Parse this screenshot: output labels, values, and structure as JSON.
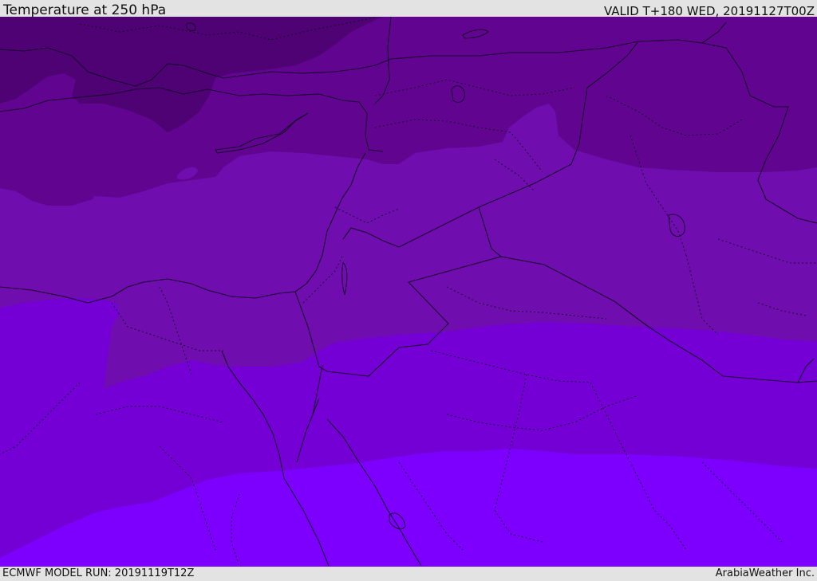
{
  "header": {
    "title": "Temperature at 250 hPa",
    "valid": "VALID T+180 WED, 20191127T00Z"
  },
  "footer": {
    "model_run": "ECMWF MODEL RUN: 20191119T12Z",
    "credit": "ArabiaWeather Inc."
  },
  "colors": {
    "band_coldest": "#4f0274",
    "band_cold": "#610590",
    "band_mid": "#700dae",
    "band_warm": "#7500d6",
    "band_warmest": "#7d00fe",
    "border_line": "#1a0030"
  }
}
